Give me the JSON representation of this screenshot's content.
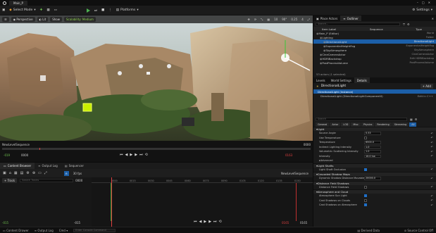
{
  "titlebar": {
    "tab": "Main_P"
  },
  "toolbar": {
    "select_mode": "Select Mode",
    "platforms": "Platforms",
    "settings": "Settings"
  },
  "viewport": {
    "perspective": "Perspective",
    "lit": "Lit",
    "show": "Show",
    "scalability": "Scalability: Medium",
    "stats": [
      "10",
      "90°",
      "0.25",
      "4"
    ]
  },
  "sequencer_strip": {
    "name": "NewLevelSequence",
    "frame_left": "-019",
    "frame_mid": "0000",
    "frame_right": "0163",
    "frame_end": "0000"
  },
  "bottom_tabs": [
    "Content Browser",
    "Output Log",
    "Sequencer"
  ],
  "sequencer": {
    "fps": "30 fps",
    "name": "NewLevelSequence",
    "add_track": "+ Track",
    "search_placeholder": "Search Tracks",
    "frame": "0000",
    "ticks": [
      "0000",
      "0015",
      "0030",
      "0045",
      "0060",
      "0075",
      "0090",
      "0105",
      "0120",
      "0135",
      "0150"
    ],
    "range_left": "-015",
    "range_right": "0165",
    "range_left2": "-015",
    "range_right2": "0165"
  },
  "outliner": {
    "tabs": [
      "Place Actors",
      "Outliner"
    ],
    "search_placeholder": "Search...",
    "columns": [
      "Item Label",
      "Sequence",
      "Type"
    ],
    "rows": [
      {
        "label": "Main_P (Editor)",
        "type": "World",
        "indent": 0
      },
      {
        "label": "Lighting",
        "type": "Folder",
        "indent": 1
      },
      {
        "label": "DirectionalLight",
        "type": "DirectionalLight",
        "indent": 2,
        "selected": true
      },
      {
        "label": "ExponentialHeightFog",
        "type": "ExponentialHeightFog",
        "indent": 2
      },
      {
        "label": "SkyAtmosphere",
        "type": "SkyAtmosphere",
        "indent": 2
      },
      {
        "label": "CineCameraActor",
        "type": "CineCameraActor",
        "indent": 1
      },
      {
        "label": "HDRIBackdrop",
        "type": "Edit HDRIBackdrop",
        "indent": 1
      },
      {
        "label": "PostProcessVolume",
        "type": "PostProcessVolume",
        "indent": 1
      }
    ],
    "count": "53 actors (1 selected)"
  },
  "details": {
    "tabs": [
      "Levels",
      "World Settings",
      "Details"
    ],
    "actor_name": "DirectionalLight",
    "add_label": "+ Add",
    "components": [
      "DirectionalLight (Instance)",
      "DirectionalLight (DirectionalLightComponent0)"
    ],
    "edit_cpp": "Edit in C++",
    "search_placeholder": "Search",
    "filters": [
      "General",
      "Actor",
      "LOD",
      "Misc",
      "Physics",
      "Rendering",
      "Streaming",
      "All"
    ],
    "sections": {
      "light": "Light",
      "light_shafts": "Light Shafts",
      "cascaded": "Cascaded Shadow Maps",
      "distance_field": "Distance Field Shadows",
      "atmosphere": "Atmosphere and Cloud"
    },
    "props": {
      "source_angle": {
        "label": "Source Angle",
        "value": "0.53"
      },
      "temperature_toggle": {
        "label": "Use Temperature"
      },
      "temperature": {
        "label": "Temperature",
        "value": "6500.0"
      },
      "indirect": {
        "label": "Indirect Lighting Intensity",
        "value": "1.0"
      },
      "volumetric": {
        "label": "Volumetric Scattering Intensity",
        "value": "1.0"
      },
      "intensity": {
        "label": "Intensity",
        "value": "10.0 lux"
      },
      "advanced": {
        "label": "Advanced"
      },
      "bloom": {
        "label": "Light Shaft Occlusion"
      },
      "dynamic_dist": {
        "label": "Dynamic Shadow Distance MovableLight",
        "value": "20000.0"
      },
      "df_shadows": {
        "label": "Distance Field Shadows"
      },
      "atmo_sun": {
        "label": "Atmosphere Sun Light"
      },
      "cast_clouds": {
        "label": "Cast Shadows on Clouds"
      },
      "cast_atmo": {
        "label": "Cast Shadows on Atmosphere"
      }
    }
  },
  "statusbar": {
    "items": [
      "Content Drawer",
      "Output Log",
      "Cmd"
    ],
    "cmd_placeholder": "Enter Console Command",
    "right": [
      "Derived Data",
      "Source Control Off"
    ]
  }
}
